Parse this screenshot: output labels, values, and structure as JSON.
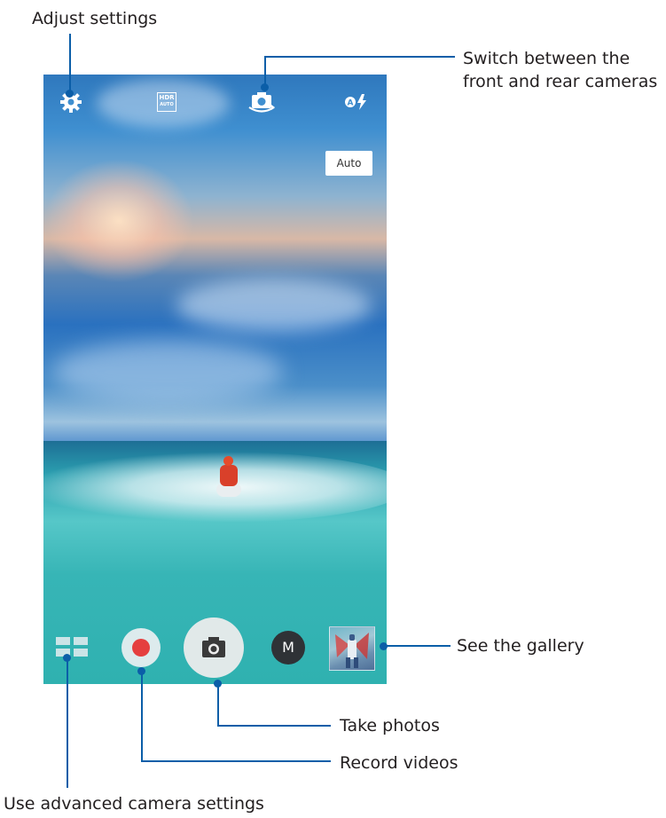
{
  "callouts": {
    "adjust_settings": "Adjust settings",
    "switch_cameras": "Switch between the\nfront and rear cameras",
    "see_gallery": "See the gallery",
    "take_photos": "Take photos",
    "record_videos": "Record videos",
    "advanced_settings": "Use advanced camera settings"
  },
  "camera": {
    "hdr_label_top": "HDR",
    "hdr_label_bottom": "AUTO",
    "scene_mode_badge": "Auto",
    "mode_button_label": "M",
    "icons": {
      "settings": "gear-icon",
      "hdr": "hdr-auto-icon",
      "switch_camera": "camera-switch-icon",
      "flash": "flash-auto-icon",
      "modules": "grid-modules-icon",
      "record": "record-icon",
      "shutter": "camera-icon",
      "gallery": "gallery-thumbnail"
    }
  },
  "colors": {
    "callout_line": "#0b5ea8",
    "record_red": "#e53f3f",
    "mode_button_bg": "#2f3236"
  }
}
